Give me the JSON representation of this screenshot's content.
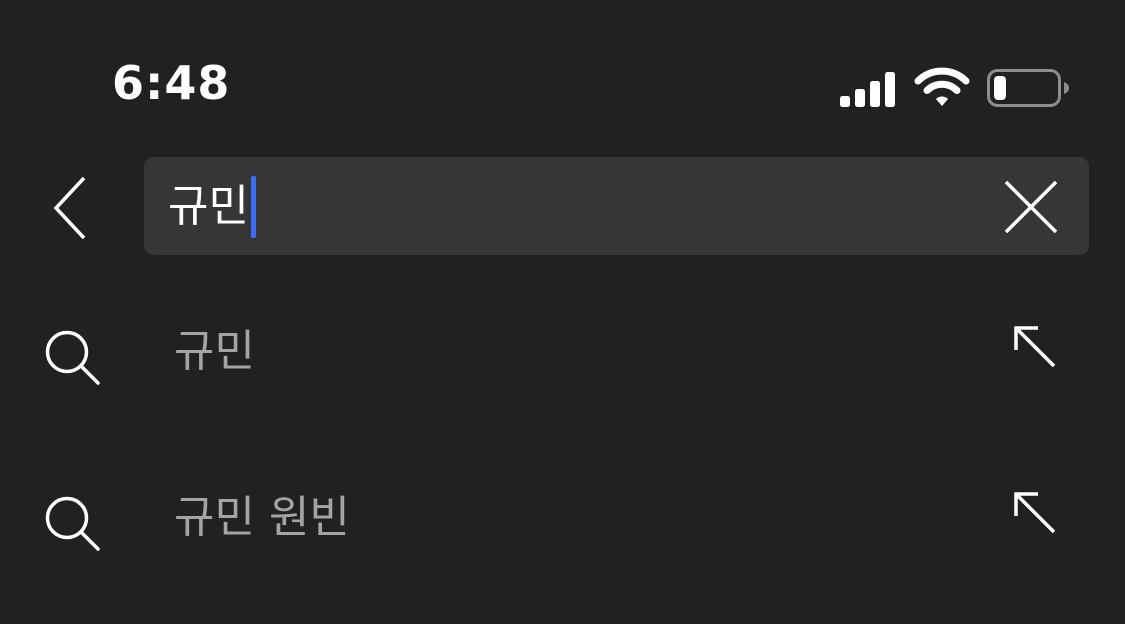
{
  "status_bar": {
    "time": "6:48",
    "signal_icon": "cellular-signal-icon",
    "wifi_icon": "wifi-icon",
    "battery_icon": "battery-low-icon",
    "battery_level": 0.2
  },
  "search": {
    "back_icon": "chevron-left-icon",
    "value": "규민",
    "clear_icon": "close-icon",
    "caret_color": "#3d6df2"
  },
  "suggestions": [
    {
      "icon": "search-icon",
      "label": "규민",
      "action_icon": "arrow-up-left-icon"
    },
    {
      "icon": "search-icon",
      "label": "규민 원빈",
      "action_icon": "arrow-up-left-icon"
    }
  ],
  "colors": {
    "background": "#212121",
    "search_field": "#363636",
    "suggestion_text": "#a4a4a4"
  }
}
